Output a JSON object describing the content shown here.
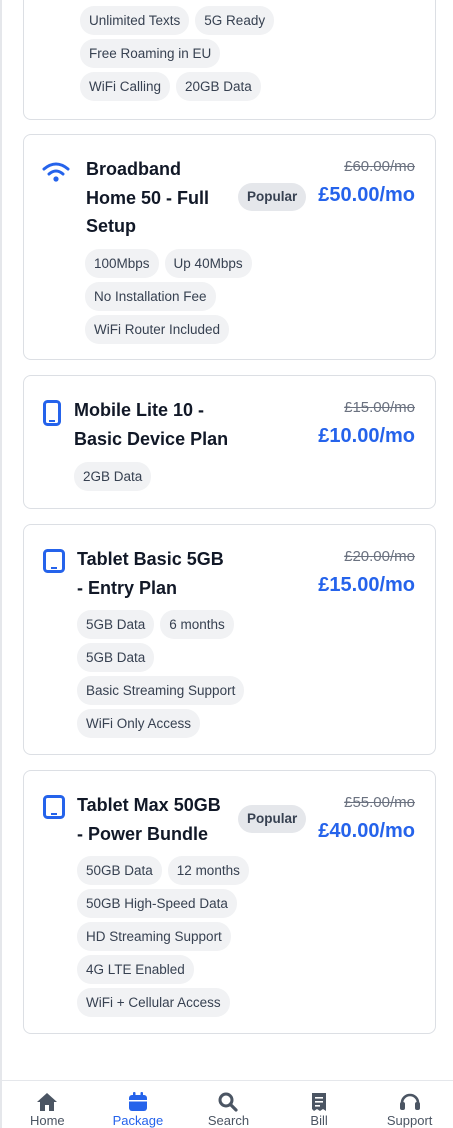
{
  "cards": [
    {
      "chips": [
        "Unlimited Texts",
        "5G Ready",
        "Free Roaming in EU",
        "WiFi Calling",
        "20GB Data"
      ]
    },
    {
      "icon": "wifi-icon",
      "title_lines": [
        "Broadband",
        "Home 50 - Full",
        "Setup"
      ],
      "badge": "Popular",
      "old_price": "£60.00/mo",
      "price": "£50.00/mo",
      "chips": [
        "100Mbps",
        "Up 40Mbps",
        "No Installation Fee",
        "WiFi Router Included"
      ]
    },
    {
      "icon": "mobile-phone-icon",
      "title_lines": [
        "Mobile Lite 10 -",
        "Basic Device Plan"
      ],
      "old_price": "£15.00/mo",
      "price": "£10.00/mo",
      "chips": [
        "2GB Data"
      ]
    },
    {
      "icon": "tablet-icon",
      "title_lines": [
        "Tablet Basic 5GB",
        "- Entry Plan"
      ],
      "old_price": "£20.00/mo",
      "price": "£15.00/mo",
      "chips": [
        "5GB Data",
        "6 months",
        "5GB Data",
        "Basic Streaming Support",
        "WiFi Only Access"
      ]
    },
    {
      "icon": "tablet-icon",
      "title_lines": [
        "Tablet Max 50GB",
        "- Power Bundle"
      ],
      "badge": "Popular",
      "old_price": "£55.00/mo",
      "price": "£40.00/mo",
      "chips": [
        "50GB Data",
        "12 months",
        "50GB High-Speed Data",
        "HD Streaming Support",
        "4G LTE Enabled",
        "WiFi + Cellular Access"
      ]
    }
  ],
  "tabs": [
    {
      "label": "Home",
      "icon": "home-icon",
      "active": false
    },
    {
      "label": "Package",
      "icon": "package-icon",
      "active": true
    },
    {
      "label": "Search",
      "icon": "search-icon",
      "active": false
    },
    {
      "label": "Bill",
      "icon": "bill-icon",
      "active": false
    },
    {
      "label": "Support",
      "icon": "headset-icon",
      "active": false
    }
  ],
  "colors": {
    "accent": "#2563eb",
    "chip_bg": "#f1f2f4",
    "badge_bg": "#e5e7eb"
  }
}
